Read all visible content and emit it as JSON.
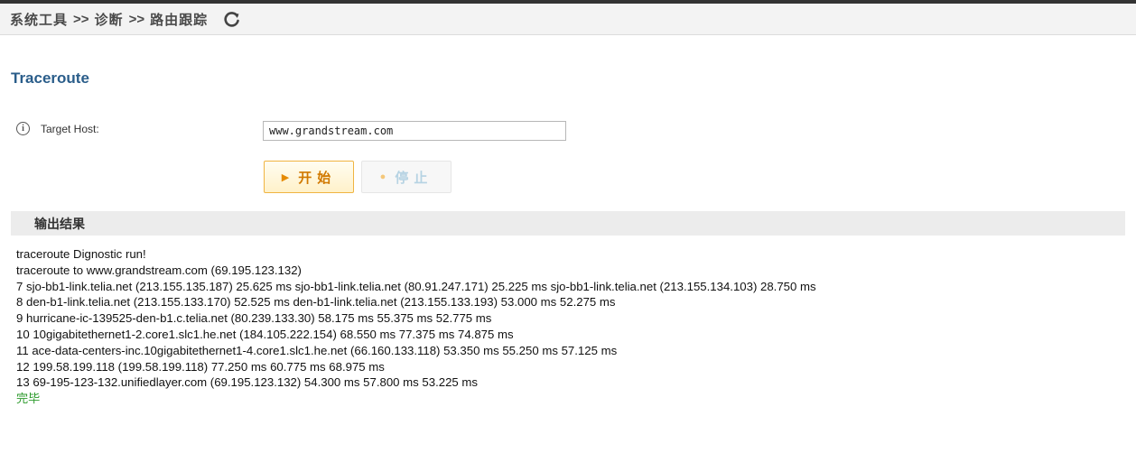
{
  "breadcrumb": [
    "系统工具",
    "诊断",
    "路由跟踪"
  ],
  "breadcrumb_sep": ">>",
  "page_title": "Traceroute",
  "form": {
    "target_host_label": "Target Host:",
    "target_host_value": "www.grandstream.com"
  },
  "buttons": {
    "start_label": "开始",
    "stop_label": "停止"
  },
  "output": {
    "header": "输出结果",
    "lines": [
      "traceroute Dignostic run!",
      "traceroute to www.grandstream.com (69.195.123.132)",
      "7 sjo-bb1-link.telia.net (213.155.135.187) 25.625 ms sjo-bb1-link.telia.net (80.91.247.171) 25.225 ms sjo-bb1-link.telia.net (213.155.134.103) 28.750 ms",
      "8 den-b1-link.telia.net (213.155.133.170) 52.525 ms den-b1-link.telia.net (213.155.133.193) 53.000 ms 52.275 ms",
      "9 hurricane-ic-139525-den-b1.c.telia.net (80.239.133.30) 58.175 ms 55.375 ms 52.775 ms",
      "10 10gigabitethernet1-2.core1.slc1.he.net (184.105.222.154) 68.550 ms 77.375 ms 74.875 ms",
      "11 ace-data-centers-inc.10gigabitethernet1-4.core1.slc1.he.net (66.160.133.118) 53.350 ms 55.250 ms 57.125 ms",
      "12 199.58.199.118 (199.58.199.118) 77.250 ms 60.775 ms 68.975 ms",
      "13 69-195-123-132.unifiedlayer.com (69.195.123.132) 54.300 ms 57.800 ms 53.225 ms"
    ],
    "done_text": "完毕"
  },
  "icons": {
    "refresh": "refresh-icon",
    "info": "info-icon",
    "start": "play-icon",
    "stop": "stop-icon"
  },
  "colors": {
    "title": "#2a5d8a",
    "start_border": "#f0b442",
    "start_text": "#d17900",
    "stop_text": "#b6d3e3",
    "done": "#2b9a2b"
  }
}
